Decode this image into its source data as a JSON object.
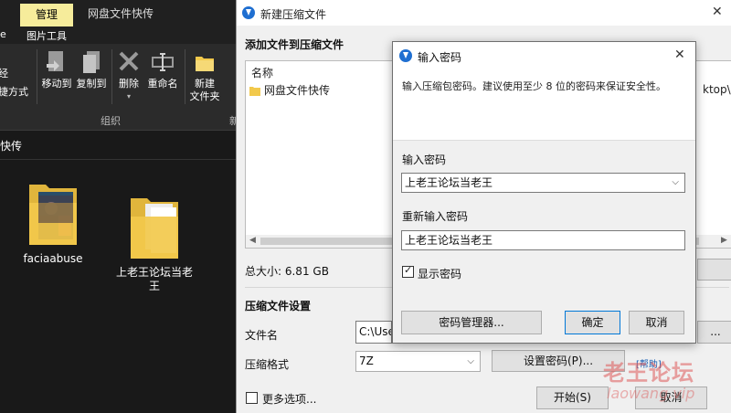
{
  "explorer": {
    "tabs": {
      "manage": "管理"
    },
    "window_title": "网盘文件快传",
    "ribbon_tab": "图片工具",
    "ribbon": {
      "left_partial_1": "经",
      "left_partial_2": "捷方式",
      "move_to": "移动到",
      "copy_to": "复制到",
      "delete": "删除",
      "rename": "重命名",
      "new_folder_line1": "新建",
      "new_folder_line2": "文件夹",
      "group_organize": "组织",
      "group_new_partial": "新"
    },
    "address_partial": "快传",
    "files": [
      {
        "name": "faciaabuse"
      },
      {
        "name": "上老王论坛当老\n王"
      }
    ]
  },
  "compress_dialog": {
    "title": "新建压缩文件",
    "add_files_header": "添加文件到压缩文件",
    "list_column_name": "名称",
    "list_item": "网盘文件快传",
    "overflow_text": "ktop\\",
    "total_size": "总大小: 6.81 GB",
    "settings_header": "压缩文件设置",
    "file_name_label": "文件名",
    "file_name_value": "C:\\Users",
    "format_label": "压缩格式",
    "format_value": "7Z",
    "set_password_button": "设置密码(P)...",
    "help_link": "[帮助]",
    "more_options": "更多选项...",
    "start_button": "开始(S)",
    "cancel_button": "取消",
    "browse_button_partial": "..."
  },
  "password_dialog": {
    "title": "输入密码",
    "description": "输入压缩包密码。建议使用至少 8 位的密码来保证安全性。",
    "password_label": "输入密码",
    "password_value": "上老王论坛当老王",
    "reenter_label": "重新输入密码",
    "reenter_value": "上老王论坛当老王",
    "show_password_label": "显示密码",
    "show_password_checked": true,
    "manager_button": "密码管理器...",
    "ok_button": "确定",
    "cancel_button": "取消"
  },
  "watermark": {
    "main": "老王论坛",
    "sub": "laowang.vip"
  },
  "colors": {
    "accent_blue": "#1f6fd1",
    "manage_tab": "#f6ec9b",
    "folder_yellow": "#f2c94c"
  }
}
